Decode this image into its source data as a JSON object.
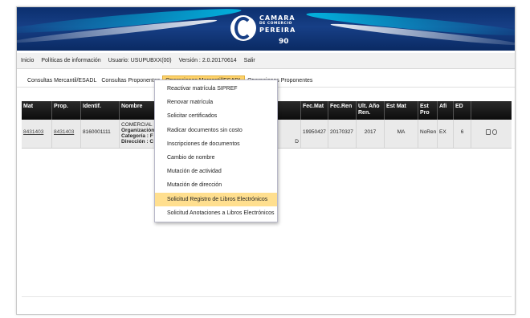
{
  "banner": {
    "logo_line1": "CAMARA",
    "logo_line2": "DE COMERCIO",
    "logo_line3": "PEREIRA",
    "logo_years": "90"
  },
  "infobar": {
    "items": [
      "Inicio",
      "Políticas de información",
      "Usuario: USUPUBXX(00)",
      "Versión : 2.0.20170614",
      "Salir"
    ]
  },
  "mainnav": {
    "items": [
      "Consultas Mercantil/ESADL",
      "Consultas Proponentes",
      "Operaciones Mercantil/ESADL",
      "Operaciones Proponentes"
    ],
    "active_index": 2
  },
  "dropdown": {
    "items": [
      "Reactivar matrícula SIPREF",
      "Renovar matrícula",
      "Solicitar certificados",
      "Radicar documentos sin costo",
      "Inscripciones de documentos",
      "Cambio de nombre",
      "Mutación de actividad",
      "Mutación de dirección",
      "Solicitud Registro de Libros Electrónicos",
      "Solicitud Anotaciones a Libros Electrónicos"
    ],
    "highlight_index": 8
  },
  "table": {
    "headers": {
      "mat": "Mat",
      "prop": "Prop.",
      "identif": "Identif.",
      "nombre": "Nombre",
      "fecmat": "Fec.Mat",
      "fecren": "Fec.Ren",
      "ult_ano_ren": "Ult. Año Ren.",
      "estmat": "Est Mat",
      "estpro": "Est Pro",
      "afi": "Afi",
      "ed": "ED"
    },
    "rows": [
      {
        "mat": "8431403",
        "prop": "8431403",
        "identif": "8160001111",
        "nombre_line1": "COMERCIAL",
        "nombre_line2": "Organización",
        "nombre_line3": "Categoría : F",
        "nombre_line4": "Dirección : C",
        "nombre_tail": "D",
        "fecmat": "19950427",
        "fecren": "20170327",
        "ult_ano_ren": "2017",
        "estmat": "MA",
        "estpro": "NoRen",
        "afi": "EX",
        "ed": "6"
      }
    ]
  }
}
